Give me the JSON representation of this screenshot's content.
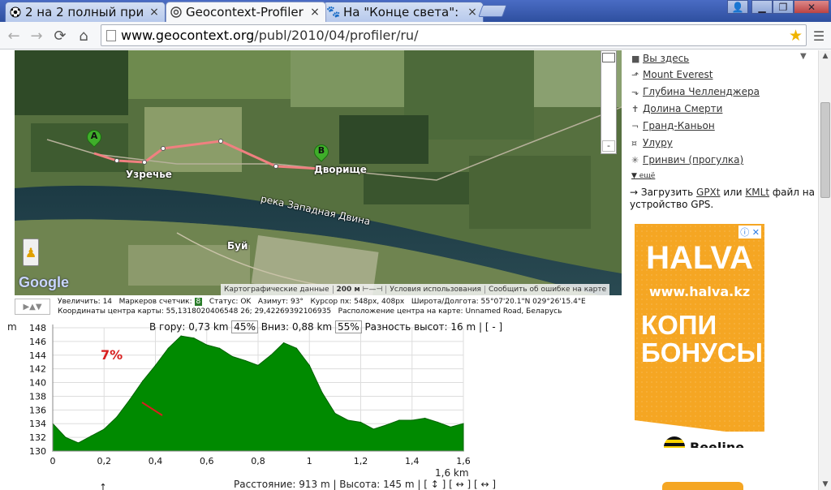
{
  "browser": {
    "tabs": [
      {
        "title": "2 на 2 полный при",
        "icon": "soccer-ball-icon",
        "active": false
      },
      {
        "title": "Geocontext-Profiler",
        "icon": "globe-icon",
        "active": true
      },
      {
        "title": "На \"Конце света\": ",
        "icon": "paw-icon",
        "active": false
      }
    ],
    "url_host": "www.geocontext.org",
    "url_path": "/publ/2010/04/profiler/ru/"
  },
  "map": {
    "labels": {
      "village1": "Узречье",
      "village2": "Дворище",
      "river": "река Западная Двина",
      "village3": "Буй"
    },
    "marker_a": "A",
    "marker_b": "B",
    "zoom_minus": "-",
    "google_logo": "Google",
    "footer": {
      "data": "Картографические данные",
      "scale": "200 м",
      "terms": "Условия использования",
      "report": "Сообщить об ошибке на карте"
    }
  },
  "status": {
    "controls": "▶▲▼",
    "zoom_label": "Увеличить:",
    "zoom_value": "14",
    "markers_label": "Маркеров счетчик:",
    "markers_value": "8",
    "state_label": "Статус:",
    "state_value": "OK",
    "azimuth_label": "Азимут:",
    "azimuth_value": "93°",
    "cursor_label": "Курсор пх:",
    "cursor_value": "548px, 408px",
    "latlon_label": "Широта/Долгота:",
    "latlon_value": "55°07'20.1\"N 029°26'15.4\"E",
    "center_label": "Координаты центра карты:",
    "center_value": "55,1318020406548 26; 29,42269392106935",
    "location_label": "Расположение центра на карте:",
    "location_value": "Unnamed Road, Беларусь"
  },
  "profile": {
    "unit": "m",
    "stats_up_label": "В гору:",
    "stats_up_value": "0,73 km",
    "stats_up_pct": "45%",
    "stats_down_label": "Вниз:",
    "stats_down_value": "0,88 km",
    "stats_down_pct": "55%",
    "stats_diff_label": "Разность высот:",
    "stats_diff_value": "16 m",
    "stats_toggle": "| [ - ]",
    "grade": "7%",
    "x_unit": "1,6 km",
    "footer": "Расстояние: 913 m  |  Высота: 145 m  |  [ ↕ ]  [ ↔ ]  [ ↔ ]"
  },
  "chart_data": {
    "type": "area",
    "x": [
      0,
      0.05,
      0.1,
      0.15,
      0.2,
      0.25,
      0.3,
      0.35,
      0.4,
      0.45,
      0.5,
      0.55,
      0.6,
      0.65,
      0.7,
      0.75,
      0.8,
      0.85,
      0.9,
      0.95,
      1.0,
      1.05,
      1.1,
      1.15,
      1.2,
      1.25,
      1.3,
      1.35,
      1.4,
      1.45,
      1.5,
      1.55,
      1.6
    ],
    "values": [
      134,
      132,
      131.2,
      132.2,
      133.2,
      135,
      137.5,
      140.2,
      142.5,
      145,
      146.8,
      146.5,
      145.5,
      145,
      143.8,
      143.2,
      142.5,
      144,
      145.8,
      145,
      142.5,
      138.5,
      135.5,
      134.5,
      134.2,
      133.2,
      133.8,
      134.5,
      134.5,
      134.8,
      134.2,
      133.5,
      134
    ],
    "xlim": [
      0,
      1.6
    ],
    "ylim": [
      130,
      148
    ],
    "xticks": [
      "0",
      "0,2",
      "0,4",
      "0,6",
      "0,8",
      "1",
      "1,2",
      "1,4",
      "1,6"
    ],
    "yticks": [
      "130",
      "132",
      "134",
      "136",
      "138",
      "140",
      "142",
      "144",
      "146",
      "148"
    ],
    "xlabel": "1,6 km",
    "ylabel": "m",
    "color": "#008a00",
    "grid": true
  },
  "sidebar": {
    "places": [
      {
        "label": "Вы здесь",
        "icon": "pin-icon"
      },
      {
        "label": "Mount Everest",
        "icon": "arrow-up-icon"
      },
      {
        "label": "Глубина Челленджера",
        "icon": "arrow-down-icon"
      },
      {
        "label": "Долина Смерти",
        "icon": "cross-icon"
      },
      {
        "label": "Гранд-Каньон",
        "icon": "bracket-icon"
      },
      {
        "label": "Улуру",
        "icon": "star-icon"
      },
      {
        "label": "Гринвич (прогулка)",
        "icon": "asterisk-icon"
      }
    ],
    "more": "▼ ещё",
    "gps_prefix": "→ Загрузить",
    "gps_gpx": "GPXt",
    "gps_or": "или",
    "gps_kml": "KMLt",
    "gps_suffix": "файл на устройство GPS."
  },
  "ad": {
    "brand": "HALVA",
    "site": "www.halva.kz",
    "headline_1": "КОПИ",
    "headline_2": "БОНУСЫ!",
    "sponsor": "Beeline"
  }
}
